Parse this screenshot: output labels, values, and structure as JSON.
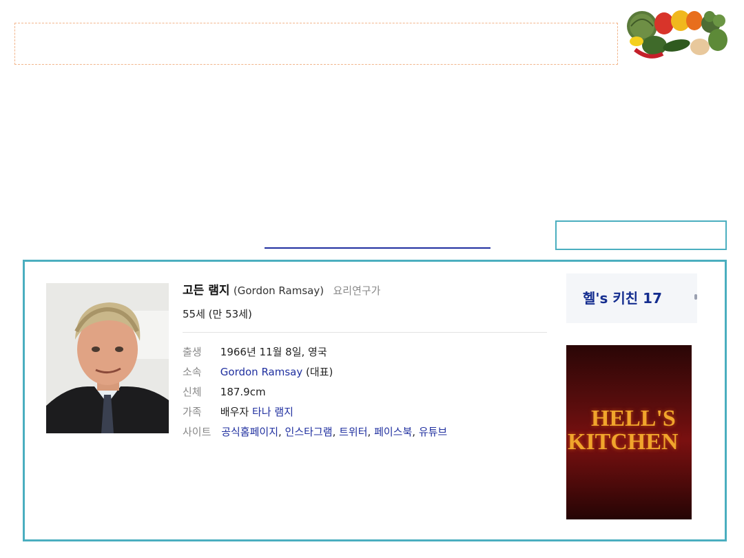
{
  "profile": {
    "name_ko": "고든 램지",
    "name_en": "(Gordon Ramsay)",
    "job": "요리연구가",
    "age": "55세 (만 53세)",
    "details": {
      "birth_label": "출생",
      "birth_value": "1966년 11월 8일, 영국",
      "affiliation_label": "소속",
      "affiliation_link": "Gordon Ramsay",
      "affiliation_suffix": "(대표)",
      "body_label": "신체",
      "body_value": "187.9cm",
      "family_label": "가족",
      "family_prefix": "배우자",
      "family_link": "타나 램지",
      "site_label": "사이트",
      "site_links": [
        "공식홈페이지",
        "인스타그램",
        "트위터",
        "페이스북",
        "유튜브"
      ]
    }
  },
  "side_tab": {
    "label": "헬's 키친 17"
  },
  "poster": {
    "line1": "HELL'S",
    "line2": "KITCHEN"
  },
  "colors": {
    "card_border": "#4aaebf",
    "link": "#1f2f9f",
    "dashed_border": "#f2b48a"
  }
}
